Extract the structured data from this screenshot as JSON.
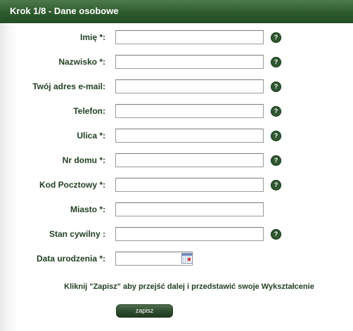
{
  "header": {
    "title": "Krok 1/8 - Dane osobowe"
  },
  "fields": [
    {
      "label": "Imię *:",
      "value": "",
      "help": "?"
    },
    {
      "label": "Nazwisko *:",
      "value": "",
      "help": "?"
    },
    {
      "label": "Twój adres e-mail:",
      "value": "",
      "help": "?"
    },
    {
      "label": "Telefon:",
      "value": "",
      "help": "?"
    },
    {
      "label": "Ulica *:",
      "value": "",
      "help": "?"
    },
    {
      "label": "Nr domu *:",
      "value": "",
      "help": "?"
    },
    {
      "label": "Kod Pocztowy *:",
      "value": "",
      "help": "?"
    },
    {
      "label": "Miasto *:",
      "value": ""
    },
    {
      "label": "Stan cywilny :",
      "value": "",
      "help": "?"
    },
    {
      "label": "Data urodzenia *:",
      "value": "",
      "icon": "calendar-icon"
    }
  ],
  "instruction": "Kliknij \"Zapisz\" aby przejść dalej i przedstawić swoje Wykształcenie",
  "submit": {
    "label": "zapisz"
  },
  "colors": {
    "header_bg": "#2d5a2d",
    "label_text": "#1f3f1f",
    "help_bg": "#2f5630",
    "button_bg": "#2c4a2c"
  }
}
